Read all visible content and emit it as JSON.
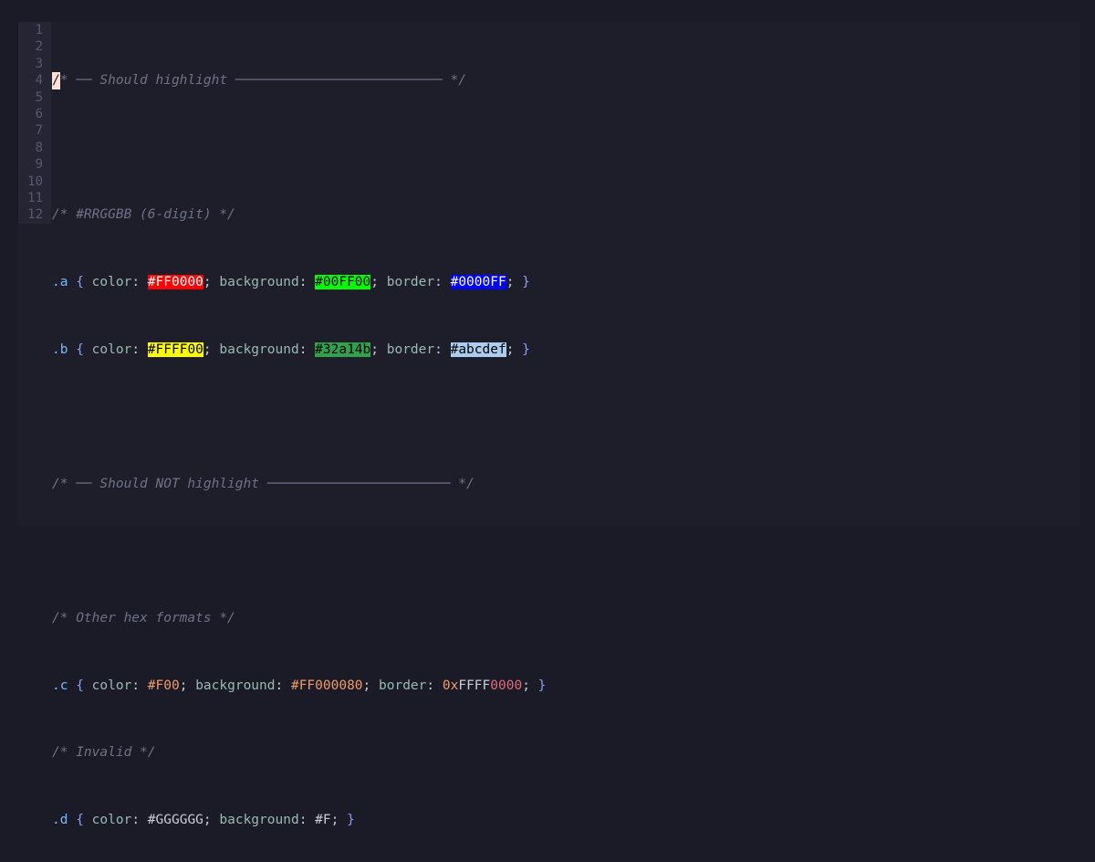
{
  "colors": {
    "background": "#1e1e2b",
    "gutter": "#252534",
    "comment": "#6e7286",
    "selector": "#79b8ff",
    "property": "#9ab9b2",
    "number": "#f09a6a"
  },
  "gutter": [
    "1",
    "2",
    "3",
    "4",
    "5",
    "6",
    "7",
    "8",
    "9",
    "10",
    "11",
    "12"
  ],
  "lines": {
    "l1_cursor": "/",
    "l1_rest": "* ── Should highlight ────────────────────────── */",
    "l3": "/* #RRGGBB (6-digit) */",
    "l4": {
      "sel": ".a",
      "open": " { ",
      "p1": "color",
      "v1": "#FF0000",
      "p2": "background",
      "v2": "#00FF00",
      "p3": "border",
      "v3": "#0000FF",
      "close": "}"
    },
    "l5": {
      "sel": ".b",
      "open": " { ",
      "p1": "color",
      "v1": "#FFFF00",
      "p2": "background",
      "v2": "#32a14b",
      "p3": "border",
      "v3": "#abcdef",
      "close": "}"
    },
    "l7": "/* ── Should NOT highlight ─────────────────────── */",
    "l9": "/* Other hex formats */",
    "l10": {
      "sel": ".c",
      "p1": "color",
      "v1": "#F00",
      "p2": "background",
      "v2": "#FF000080",
      "p3": "border",
      "v3a": "0x",
      "v3b": "FFFF",
      "v3c": "0000",
      "close": "}"
    },
    "l11": "/* Invalid */",
    "l12": {
      "sel": ".d",
      "p1": "color",
      "v1": "#GGGGGG",
      "p2": "background",
      "v2": "#F",
      "close": "}"
    }
  }
}
